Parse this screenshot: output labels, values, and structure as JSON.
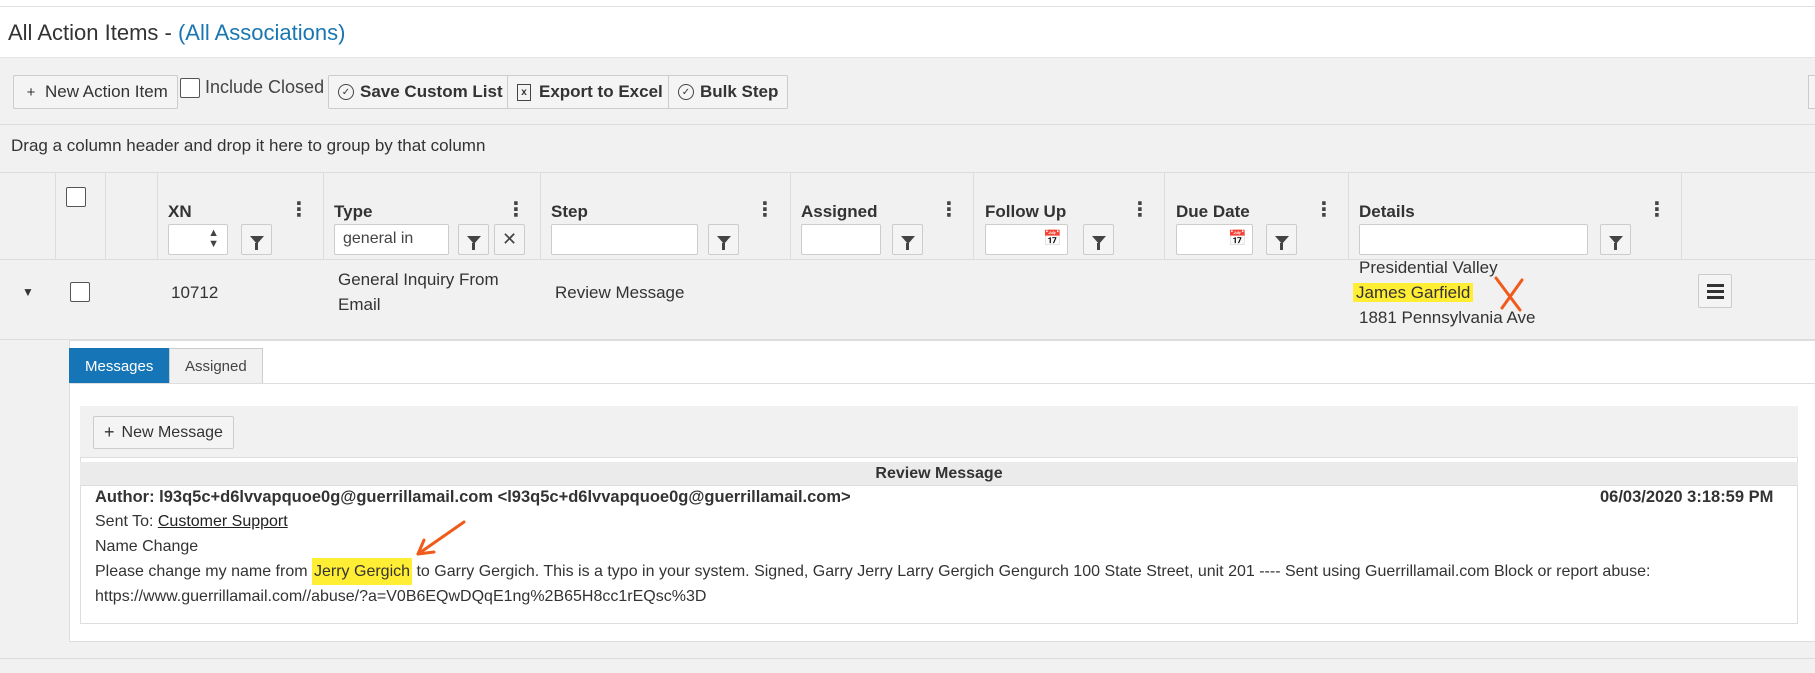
{
  "page": {
    "title": "All Action Items - ",
    "association_link": "(All Associations)"
  },
  "toolbar": {
    "new_action_item": "New Action Item",
    "include_closed": "Include Closed",
    "save_custom_list": "Save Custom List",
    "export_to_excel": "Export to Excel",
    "bulk_step": "Bulk Step"
  },
  "grid": {
    "group_hint": "Drag a column header and drop it here to group by that column",
    "columns": [
      "XN",
      "Type",
      "Step",
      "Assigned",
      "Follow Up",
      "Due Date",
      "Details"
    ],
    "filters": {
      "type": "general in"
    },
    "row": {
      "xn": "10712",
      "type_line1": "General Inquiry From",
      "type_line2": "Email",
      "step": "Review Message",
      "details_line1": "Presidential Valley",
      "details_line2": "James Garfield",
      "details_line3": "1881 Pennsylvania Ave"
    }
  },
  "detail": {
    "tabs": [
      "Messages",
      "Assigned"
    ],
    "new_message": "New Message",
    "section_title": "Review Message",
    "message": {
      "author": "Author: l93q5c+d6lvvapquoe0g@guerrillamail.com <l93q5c+d6lvvapquoe0g@guerrillamail.com>",
      "date": "06/03/2020 3:18:59 PM",
      "sent_to_label": "Sent To: ",
      "sent_to": "Customer Support",
      "subject": "Name Change",
      "body_pre": "Please change my name from ",
      "body_highlight": "Jerry Gergich",
      "body_post": " to Garry Gergich. This is a typo in your system. Signed, Garry Jerry Larry Gergich Gengurch 100 State Street, unit 201 ---- Sent using Guerrillamail.com Block or report abuse:",
      "body_line2": "https://www.guerrillamail.com//abuse/?a=V0B6EQwDQqE1ng%2B65H8cc1rEQsc%3D"
    }
  },
  "colors": {
    "accent": "#1575b7",
    "highlight": "#ffee33",
    "annotation": "#f05a1a"
  }
}
